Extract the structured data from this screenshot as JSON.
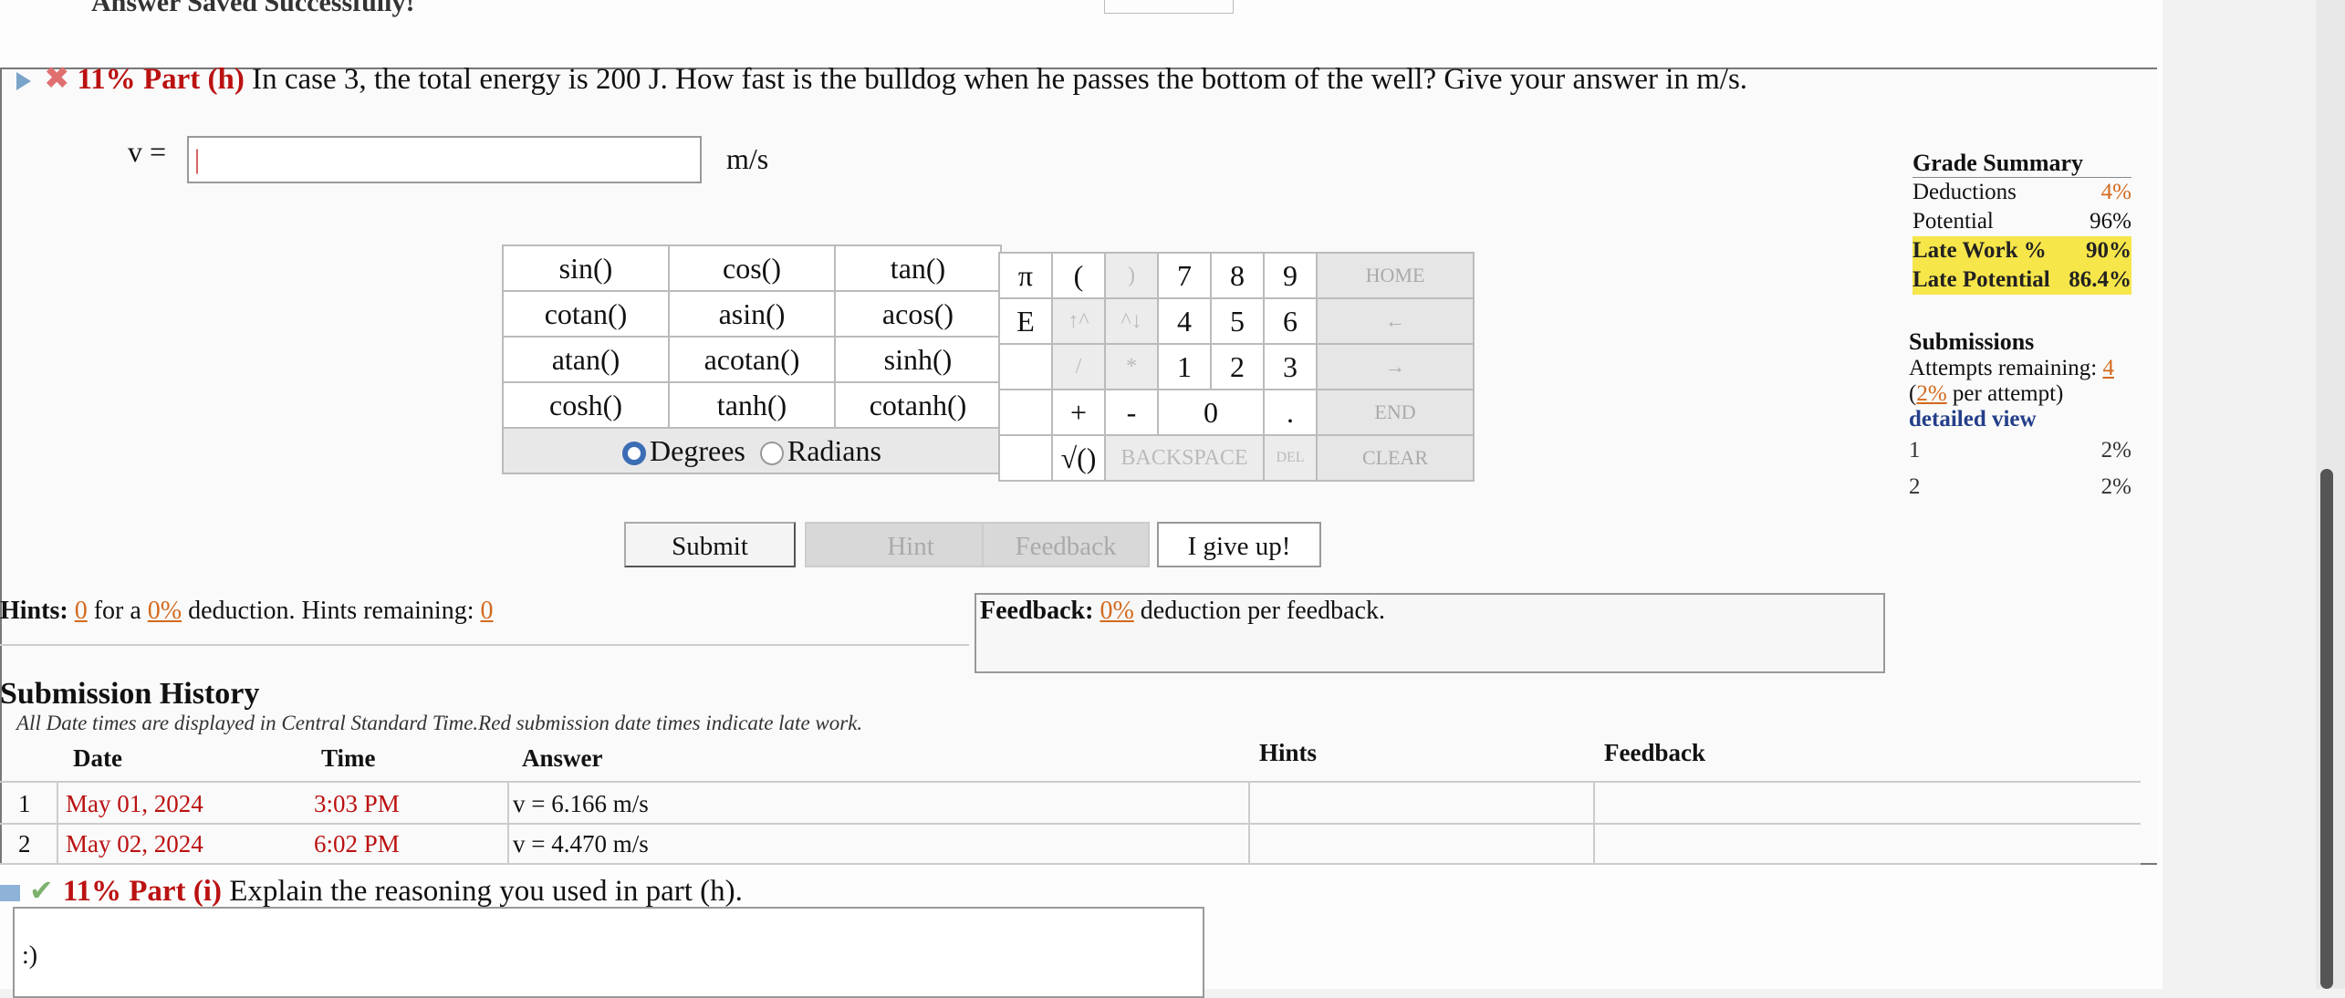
{
  "top": {
    "saved_msg": "Answer Saved Successfully!"
  },
  "part_h": {
    "percent": "11%",
    "label": "Part (h)",
    "question": "In case 3, the total energy is 200 J. How fast is the bulldog when he passes the bottom of the well? Give your answer in m/s.",
    "var_label": "v =",
    "input_value": "|",
    "units": "m/s"
  },
  "calculator": {
    "functions": [
      [
        "sin()",
        "cos()",
        "tan()"
      ],
      [
        "cotan()",
        "asin()",
        "acos()"
      ],
      [
        "atan()",
        "acotan()",
        "sinh()"
      ],
      [
        "cosh()",
        "tanh()",
        "cotanh()"
      ]
    ],
    "degrees": "Degrees",
    "radians": "Radians",
    "keys": {
      "pi": "π",
      "open": "(",
      "close": ")",
      "seven": "7",
      "eight": "8",
      "nine": "9",
      "home": "HOME",
      "e": "E",
      "up": "↑^",
      "down": "^↓",
      "four": "4",
      "five": "5",
      "six": "6",
      "left": "←",
      "div": "/",
      "mul": "*",
      "one": "1",
      "two": "2",
      "three": "3",
      "right": "→",
      "plus": "+",
      "minus": "-",
      "zero": "0",
      "dot": ".",
      "end": "END",
      "sqrt": "√()",
      "backspace": "BACKSPACE",
      "del": "DEL",
      "clear": "CLEAR"
    }
  },
  "buttons": {
    "submit": "Submit",
    "hint": "Hint",
    "feedback": "Feedback",
    "give_up": "I give up!"
  },
  "hints": {
    "prefix": "Hints:",
    "count": "0",
    "for_a": "for a",
    "deduction": "0%",
    "mid": "deduction. Hints remaining:",
    "remaining": "0"
  },
  "feedback": {
    "prefix": "Feedback:",
    "deduction": "0%",
    "suffix": "deduction per feedback."
  },
  "grade_summary": {
    "title": "Grade Summary",
    "deductions_label": "Deductions",
    "deductions": "4%",
    "potential_label": "Potential",
    "potential": "96%",
    "late_work_label": "Late Work %",
    "late_work": "90%",
    "late_potential_label": "Late Potential",
    "late_potential": "86.4%"
  },
  "submissions": {
    "title": "Submissions",
    "attempts_label": "Attempts remaining:",
    "attempts": "4",
    "per_attempt_pct": "2%",
    "per_attempt_suffix": "per attempt)",
    "per_attempt_open": "(",
    "detailed": "detailed view",
    "rows": [
      {
        "n": "1",
        "pct": "2%"
      },
      {
        "n": "2",
        "pct": "2%"
      }
    ]
  },
  "history": {
    "title": "Submission History",
    "note": "All Date times are displayed in Central Standard Time.Red submission date times indicate late work.",
    "headers": {
      "date": "Date",
      "time": "Time",
      "answer": "Answer",
      "hints": "Hints",
      "feedback": "Feedback"
    },
    "rows": [
      {
        "n": "1",
        "date": "May 01, 2024",
        "time": "3:03 PM",
        "answer": "v = 6.166  m/s"
      },
      {
        "n": "2",
        "date": "May 02, 2024",
        "time": "6:02 PM",
        "answer": "v = 4.470  m/s"
      }
    ]
  },
  "part_i": {
    "percent": "11%",
    "label": "Part (i)",
    "question": "Explain the reasoning you used in part (h).",
    "response": ":)"
  }
}
